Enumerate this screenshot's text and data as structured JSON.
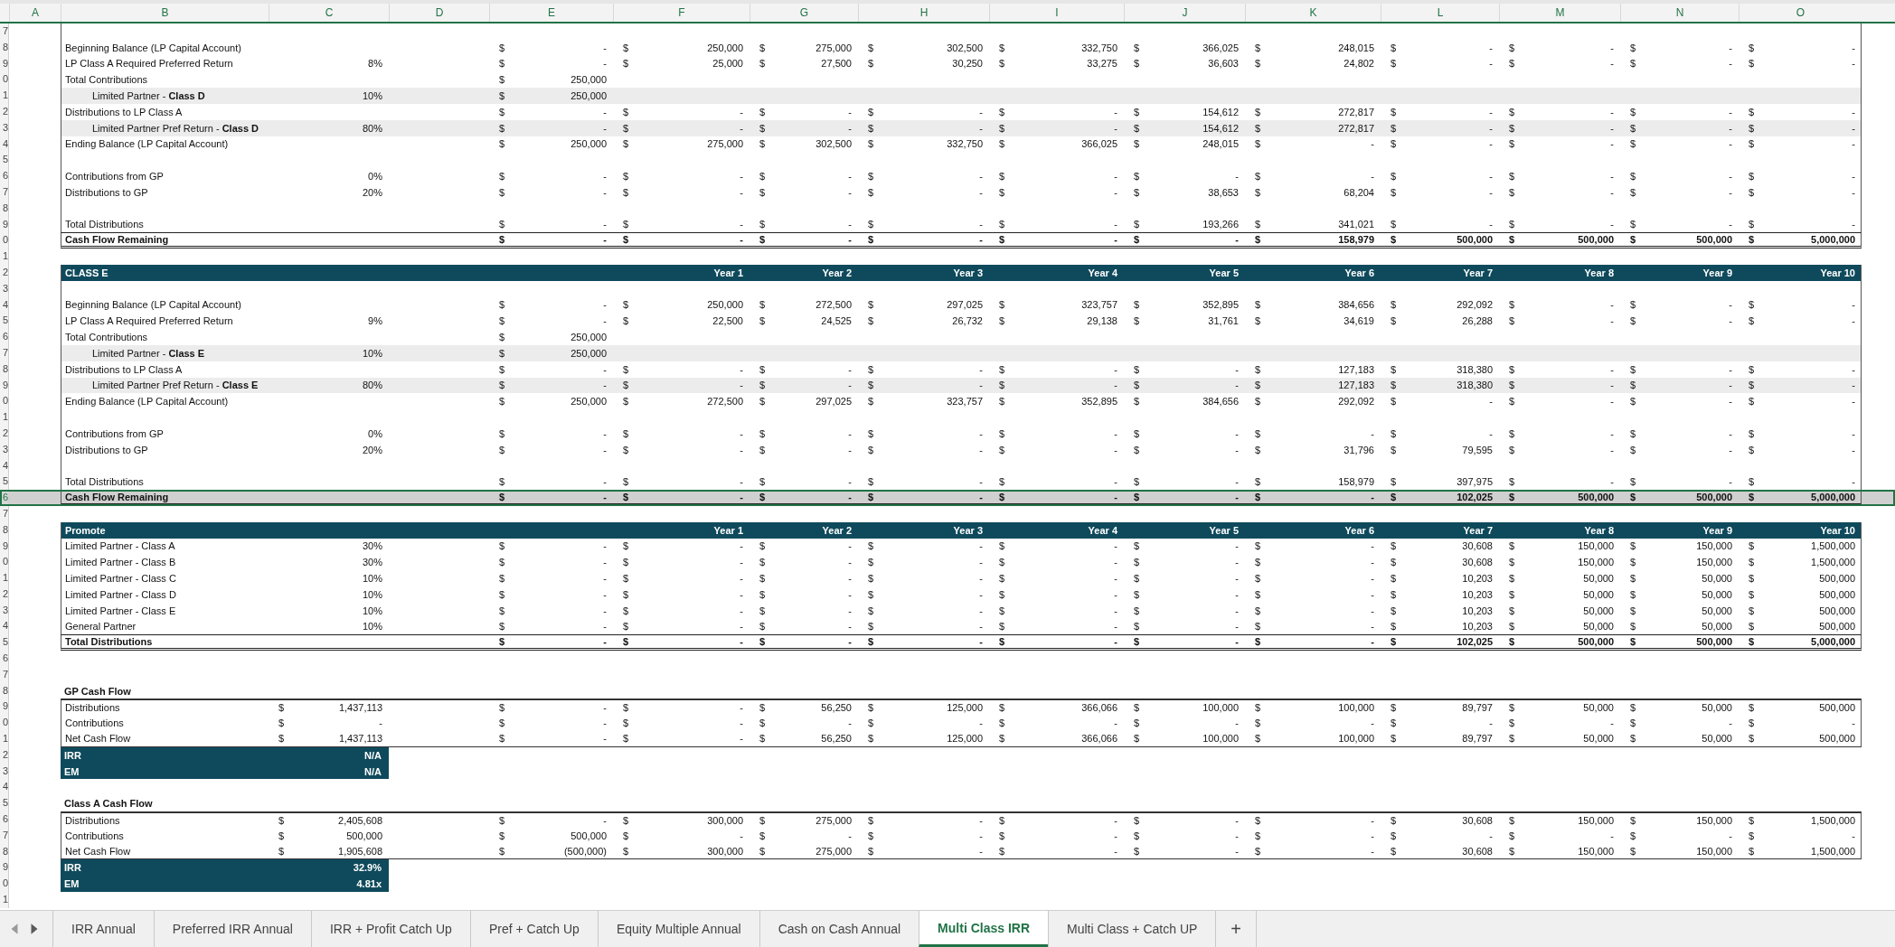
{
  "columns": [
    "A",
    "B",
    "C",
    "D",
    "E",
    "F",
    "G",
    "H",
    "I",
    "J",
    "K",
    "L",
    "M",
    "N",
    "O"
  ],
  "blocks": [
    {
      "kind": "box",
      "rows": [
        {
          "n": "7",
          "kind": "blank",
          "selected": false
        },
        {
          "n": "8",
          "kind": "item",
          "selected": false,
          "label": "Beginning Balance (LP Capital Account)",
          "cells": [
            null,
            null,
            [
              "$",
              "-"
            ],
            [
              "$",
              "250,000"
            ],
            [
              "$",
              "275,000"
            ],
            [
              "$",
              "302,500"
            ],
            [
              "$",
              "332,750"
            ],
            [
              "$",
              "366,025"
            ],
            [
              "$",
              "248,015"
            ],
            [
              "$",
              "-"
            ],
            [
              "$",
              "-"
            ],
            [
              "$",
              "-"
            ],
            [
              "$",
              "-"
            ]
          ]
        },
        {
          "n": "9",
          "kind": "item",
          "selected": false,
          "label": "LP Class A Required Preferred Return",
          "cells": [
            "8%",
            null,
            [
              "$",
              "-"
            ],
            [
              "$",
              "25,000"
            ],
            [
              "$",
              "27,500"
            ],
            [
              "$",
              "30,250"
            ],
            [
              "$",
              "33,275"
            ],
            [
              "$",
              "36,603"
            ],
            [
              "$",
              "24,802"
            ],
            [
              "$",
              "-"
            ],
            [
              "$",
              "-"
            ],
            [
              "$",
              "-"
            ],
            [
              "$",
              "-"
            ]
          ]
        },
        {
          "n": "0",
          "kind": "item",
          "selected": false,
          "label": "Total Contributions",
          "cells": [
            null,
            null,
            [
              "$",
              "250,000"
            ],
            null,
            null,
            null,
            null,
            null,
            null,
            null,
            null,
            null,
            null
          ]
        },
        {
          "n": "1",
          "kind": "sub",
          "selected": false,
          "label": "Limited Partner - **Class D**",
          "cells": [
            "10%",
            null,
            [
              "$",
              "250,000"
            ],
            null,
            null,
            null,
            null,
            null,
            null,
            null,
            null,
            null,
            null
          ]
        },
        {
          "n": "2",
          "kind": "item",
          "selected": false,
          "label": "Distributions to LP Class A",
          "cells": [
            null,
            null,
            [
              "$",
              "-"
            ],
            [
              "$",
              "-"
            ],
            [
              "$",
              "-"
            ],
            [
              "$",
              "-"
            ],
            [
              "$",
              "-"
            ],
            [
              "$",
              "154,612"
            ],
            [
              "$",
              "272,817"
            ],
            [
              "$",
              "-"
            ],
            [
              "$",
              "-"
            ],
            [
              "$",
              "-"
            ],
            [
              "$",
              "-"
            ]
          ]
        },
        {
          "n": "3",
          "kind": "sub",
          "selected": false,
          "label": "Limited Partner Pref Return - **Class D**",
          "cells": [
            "80%",
            null,
            [
              "$",
              "-"
            ],
            [
              "$",
              "-"
            ],
            [
              "$",
              "-"
            ],
            [
              "$",
              "-"
            ],
            [
              "$",
              "-"
            ],
            [
              "$",
              "154,612"
            ],
            [
              "$",
              "272,817"
            ],
            [
              "$",
              "-"
            ],
            [
              "$",
              "-"
            ],
            [
              "$",
              "-"
            ],
            [
              "$",
              "-"
            ]
          ]
        },
        {
          "n": "4",
          "kind": "item",
          "selected": false,
          "label": "Ending Balance (LP Capital Account)",
          "cells": [
            null,
            null,
            [
              "$",
              "250,000"
            ],
            [
              "$",
              "275,000"
            ],
            [
              "$",
              "302,500"
            ],
            [
              "$",
              "332,750"
            ],
            [
              "$",
              "366,025"
            ],
            [
              "$",
              "248,015"
            ],
            [
              "$",
              "-"
            ],
            [
              "$",
              "-"
            ],
            [
              "$",
              "-"
            ],
            [
              "$",
              "-"
            ],
            [
              "$",
              "-"
            ]
          ]
        },
        {
          "n": "5",
          "kind": "blank",
          "selected": false
        },
        {
          "n": "6",
          "kind": "item",
          "selected": false,
          "label": "Contributions from GP",
          "cells": [
            "0%",
            null,
            [
              "$",
              "-"
            ],
            [
              "$",
              "-"
            ],
            [
              "$",
              "-"
            ],
            [
              "$",
              "-"
            ],
            [
              "$",
              "-"
            ],
            [
              "$",
              "-"
            ],
            [
              "$",
              "-"
            ],
            [
              "$",
              "-"
            ],
            [
              "$",
              "-"
            ],
            [
              "$",
              "-"
            ],
            [
              "$",
              "-"
            ]
          ]
        },
        {
          "n": "7",
          "kind": "item",
          "selected": false,
          "label": "Distributions to GP",
          "cells": [
            "20%",
            null,
            [
              "$",
              "-"
            ],
            [
              "$",
              "-"
            ],
            [
              "$",
              "-"
            ],
            [
              "$",
              "-"
            ],
            [
              "$",
              "-"
            ],
            [
              "$",
              "38,653"
            ],
            [
              "$",
              "68,204"
            ],
            [
              "$",
              "-"
            ],
            [
              "$",
              "-"
            ],
            [
              "$",
              "-"
            ],
            [
              "$",
              "-"
            ]
          ]
        },
        {
          "n": "8",
          "kind": "blank",
          "selected": false
        },
        {
          "n": "9",
          "kind": "item",
          "selected": false,
          "label": "Total Distributions",
          "cells": [
            null,
            null,
            [
              "$",
              "-"
            ],
            [
              "$",
              "-"
            ],
            [
              "$",
              "-"
            ],
            [
              "$",
              "-"
            ],
            [
              "$",
              "-"
            ],
            [
              "$",
              "193,266"
            ],
            [
              "$",
              "341,021"
            ],
            [
              "$",
              "-"
            ],
            [
              "$",
              "-"
            ],
            [
              "$",
              "-"
            ],
            [
              "$",
              "-"
            ]
          ]
        },
        {
          "n": "0",
          "kind": "total",
          "selected": false,
          "label": "Cash Flow Remaining",
          "cells": [
            null,
            null,
            [
              "$",
              "-"
            ],
            [
              "$",
              "-"
            ],
            [
              "$",
              "-"
            ],
            [
              "$",
              "-"
            ],
            [
              "$",
              "-"
            ],
            [
              "$",
              "-"
            ],
            [
              "$",
              "158,979"
            ],
            [
              "$",
              "500,000"
            ],
            [
              "$",
              "500,000"
            ],
            [
              "$",
              "500,000"
            ],
            [
              "$",
              "5,000,000"
            ]
          ]
        }
      ]
    },
    {
      "kind": "plain",
      "rows": [
        {
          "n": "1",
          "kind": "blank",
          "selected": false
        }
      ]
    },
    {
      "kind": "box",
      "rows": [
        {
          "n": "2",
          "kind": "header",
          "selected": false,
          "label": "CLASS E",
          "cells": [
            null,
            null,
            null,
            "Year 1",
            "Year 2",
            "Year 3",
            "Year 4",
            "Year 5",
            "Year 6",
            "Year 7",
            "Year 8",
            "Year 9",
            "Year 10"
          ]
        },
        {
          "n": "3",
          "kind": "blank",
          "selected": false
        },
        {
          "n": "4",
          "kind": "item",
          "selected": false,
          "label": "Beginning Balance (LP Capital Account)",
          "cells": [
            null,
            null,
            [
              "$",
              "-"
            ],
            [
              "$",
              "250,000"
            ],
            [
              "$",
              "272,500"
            ],
            [
              "$",
              "297,025"
            ],
            [
              "$",
              "323,757"
            ],
            [
              "$",
              "352,895"
            ],
            [
              "$",
              "384,656"
            ],
            [
              "$",
              "292,092"
            ],
            [
              "$",
              "-"
            ],
            [
              "$",
              "-"
            ],
            [
              "$",
              "-"
            ]
          ]
        },
        {
          "n": "5",
          "kind": "item",
          "selected": false,
          "label": "LP Class A Required Preferred Return",
          "cells": [
            "9%",
            null,
            [
              "$",
              "-"
            ],
            [
              "$",
              "22,500"
            ],
            [
              "$",
              "24,525"
            ],
            [
              "$",
              "26,732"
            ],
            [
              "$",
              "29,138"
            ],
            [
              "$",
              "31,761"
            ],
            [
              "$",
              "34,619"
            ],
            [
              "$",
              "26,288"
            ],
            [
              "$",
              "-"
            ],
            [
              "$",
              "-"
            ],
            [
              "$",
              "-"
            ]
          ]
        },
        {
          "n": "6",
          "kind": "item",
          "selected": false,
          "label": "Total Contributions",
          "cells": [
            null,
            null,
            [
              "$",
              "250,000"
            ],
            null,
            null,
            null,
            null,
            null,
            null,
            null,
            null,
            null,
            null
          ]
        },
        {
          "n": "7",
          "kind": "sub",
          "selected": false,
          "label": "Limited Partner - **Class E**",
          "cells": [
            "10%",
            null,
            [
              "$",
              "250,000"
            ],
            null,
            null,
            null,
            null,
            null,
            null,
            null,
            null,
            null,
            null
          ]
        },
        {
          "n": "8",
          "kind": "item",
          "selected": false,
          "label": "Distributions to LP Class A",
          "cells": [
            null,
            null,
            [
              "$",
              "-"
            ],
            [
              "$",
              "-"
            ],
            [
              "$",
              "-"
            ],
            [
              "$",
              "-"
            ],
            [
              "$",
              "-"
            ],
            [
              "$",
              "-"
            ],
            [
              "$",
              "127,183"
            ],
            [
              "$",
              "318,380"
            ],
            [
              "$",
              "-"
            ],
            [
              "$",
              "-"
            ],
            [
              "$",
              "-"
            ]
          ]
        },
        {
          "n": "9",
          "kind": "sub",
          "selected": false,
          "label": "Limited Partner Pref Return - **Class E**",
          "cells": [
            "80%",
            null,
            [
              "$",
              "-"
            ],
            [
              "$",
              "-"
            ],
            [
              "$",
              "-"
            ],
            [
              "$",
              "-"
            ],
            [
              "$",
              "-"
            ],
            [
              "$",
              "-"
            ],
            [
              "$",
              "127,183"
            ],
            [
              "$",
              "318,380"
            ],
            [
              "$",
              "-"
            ],
            [
              "$",
              "-"
            ],
            [
              "$",
              "-"
            ]
          ]
        },
        {
          "n": "0",
          "kind": "item",
          "selected": false,
          "label": "Ending Balance (LP Capital Account)",
          "cells": [
            null,
            null,
            [
              "$",
              "250,000"
            ],
            [
              "$",
              "272,500"
            ],
            [
              "$",
              "297,025"
            ],
            [
              "$",
              "323,757"
            ],
            [
              "$",
              "352,895"
            ],
            [
              "$",
              "384,656"
            ],
            [
              "$",
              "292,092"
            ],
            [
              "$",
              "-"
            ],
            [
              "$",
              "-"
            ],
            [
              "$",
              "-"
            ],
            [
              "$",
              "-"
            ]
          ]
        },
        {
          "n": "1",
          "kind": "blank",
          "selected": false
        },
        {
          "n": "2",
          "kind": "item",
          "selected": false,
          "label": "Contributions from GP",
          "cells": [
            "0%",
            null,
            [
              "$",
              "-"
            ],
            [
              "$",
              "-"
            ],
            [
              "$",
              "-"
            ],
            [
              "$",
              "-"
            ],
            [
              "$",
              "-"
            ],
            [
              "$",
              "-"
            ],
            [
              "$",
              "-"
            ],
            [
              "$",
              "-"
            ],
            [
              "$",
              "-"
            ],
            [
              "$",
              "-"
            ],
            [
              "$",
              "-"
            ]
          ]
        },
        {
          "n": "3",
          "kind": "item",
          "selected": false,
          "label": "Distributions to GP",
          "cells": [
            "20%",
            null,
            [
              "$",
              "-"
            ],
            [
              "$",
              "-"
            ],
            [
              "$",
              "-"
            ],
            [
              "$",
              "-"
            ],
            [
              "$",
              "-"
            ],
            [
              "$",
              "-"
            ],
            [
              "$",
              "31,796"
            ],
            [
              "$",
              "79,595"
            ],
            [
              "$",
              "-"
            ],
            [
              "$",
              "-"
            ],
            [
              "$",
              "-"
            ]
          ]
        },
        {
          "n": "4",
          "kind": "blank",
          "selected": false
        },
        {
          "n": "5",
          "kind": "item",
          "selected": false,
          "label": "Total Distributions",
          "cells": [
            null,
            null,
            [
              "$",
              "-"
            ],
            [
              "$",
              "-"
            ],
            [
              "$",
              "-"
            ],
            [
              "$",
              "-"
            ],
            [
              "$",
              "-"
            ],
            [
              "$",
              "-"
            ],
            [
              "$",
              "158,979"
            ],
            [
              "$",
              "397,975"
            ],
            [
              "$",
              "-"
            ],
            [
              "$",
              "-"
            ],
            [
              "$",
              "-"
            ]
          ]
        },
        {
          "n": "6",
          "kind": "total",
          "selected": true,
          "label": "Cash Flow Remaining",
          "cells": [
            null,
            null,
            [
              "$",
              "-"
            ],
            [
              "$",
              "-"
            ],
            [
              "$",
              "-"
            ],
            [
              "$",
              "-"
            ],
            [
              "$",
              "-"
            ],
            [
              "$",
              "-"
            ],
            [
              "$",
              "-"
            ],
            [
              "$",
              "102,025"
            ],
            [
              "$",
              "500,000"
            ],
            [
              "$",
              "500,000"
            ],
            [
              "$",
              "5,000,000"
            ]
          ]
        }
      ]
    },
    {
      "kind": "plain",
      "rows": [
        {
          "n": "7",
          "kind": "blank",
          "selected": false
        }
      ]
    },
    {
      "kind": "box",
      "rows": [
        {
          "n": "8",
          "kind": "header",
          "selected": false,
          "label": "Promote",
          "cells": [
            null,
            null,
            null,
            "Year 1",
            "Year 2",
            "Year 3",
            "Year 4",
            "Year 5",
            "Year 6",
            "Year 7",
            "Year 8",
            "Year 9",
            "Year 10"
          ]
        },
        {
          "n": "9",
          "kind": "item",
          "selected": false,
          "label": "Limited Partner - Class A",
          "cells": [
            "30%",
            null,
            [
              "$",
              "-"
            ],
            [
              "$",
              "-"
            ],
            [
              "$",
              "-"
            ],
            [
              "$",
              "-"
            ],
            [
              "$",
              "-"
            ],
            [
              "$",
              "-"
            ],
            [
              "$",
              "-"
            ],
            [
              "$",
              "30,608"
            ],
            [
              "$",
              "150,000"
            ],
            [
              "$",
              "150,000"
            ],
            [
              "$",
              "1,500,000"
            ]
          ]
        },
        {
          "n": "0",
          "kind": "item",
          "selected": false,
          "label": "Limited Partner - Class B",
          "cells": [
            "30%",
            null,
            [
              "$",
              "-"
            ],
            [
              "$",
              "-"
            ],
            [
              "$",
              "-"
            ],
            [
              "$",
              "-"
            ],
            [
              "$",
              "-"
            ],
            [
              "$",
              "-"
            ],
            [
              "$",
              "-"
            ],
            [
              "$",
              "30,608"
            ],
            [
              "$",
              "150,000"
            ],
            [
              "$",
              "150,000"
            ],
            [
              "$",
              "1,500,000"
            ]
          ]
        },
        {
          "n": "1",
          "kind": "item",
          "selected": false,
          "label": "Limited Partner - Class C",
          "cells": [
            "10%",
            null,
            [
              "$",
              "-"
            ],
            [
              "$",
              "-"
            ],
            [
              "$",
              "-"
            ],
            [
              "$",
              "-"
            ],
            [
              "$",
              "-"
            ],
            [
              "$",
              "-"
            ],
            [
              "$",
              "-"
            ],
            [
              "$",
              "10,203"
            ],
            [
              "$",
              "50,000"
            ],
            [
              "$",
              "50,000"
            ],
            [
              "$",
              "500,000"
            ]
          ]
        },
        {
          "n": "2",
          "kind": "item",
          "selected": false,
          "label": "Limited Partner - Class D",
          "cells": [
            "10%",
            null,
            [
              "$",
              "-"
            ],
            [
              "$",
              "-"
            ],
            [
              "$",
              "-"
            ],
            [
              "$",
              "-"
            ],
            [
              "$",
              "-"
            ],
            [
              "$",
              "-"
            ],
            [
              "$",
              "-"
            ],
            [
              "$",
              "10,203"
            ],
            [
              "$",
              "50,000"
            ],
            [
              "$",
              "50,000"
            ],
            [
              "$",
              "500,000"
            ]
          ]
        },
        {
          "n": "3",
          "kind": "item",
          "selected": false,
          "label": "Limited Partner - Class E",
          "cells": [
            "10%",
            null,
            [
              "$",
              "-"
            ],
            [
              "$",
              "-"
            ],
            [
              "$",
              "-"
            ],
            [
              "$",
              "-"
            ],
            [
              "$",
              "-"
            ],
            [
              "$",
              "-"
            ],
            [
              "$",
              "-"
            ],
            [
              "$",
              "10,203"
            ],
            [
              "$",
              "50,000"
            ],
            [
              "$",
              "50,000"
            ],
            [
              "$",
              "500,000"
            ]
          ]
        },
        {
          "n": "4",
          "kind": "item",
          "selected": false,
          "label": "General Partner",
          "cells": [
            "10%",
            null,
            [
              "$",
              "-"
            ],
            [
              "$",
              "-"
            ],
            [
              "$",
              "-"
            ],
            [
              "$",
              "-"
            ],
            [
              "$",
              "-"
            ],
            [
              "$",
              "-"
            ],
            [
              "$",
              "-"
            ],
            [
              "$",
              "10,203"
            ],
            [
              "$",
              "50,000"
            ],
            [
              "$",
              "50,000"
            ],
            [
              "$",
              "500,000"
            ]
          ]
        },
        {
          "n": "5",
          "kind": "total",
          "selected": false,
          "label": "Total Distributions",
          "cells": [
            null,
            null,
            [
              "$",
              "-"
            ],
            [
              "$",
              "-"
            ],
            [
              "$",
              "-"
            ],
            [
              "$",
              "-"
            ],
            [
              "$",
              "-"
            ],
            [
              "$",
              "-"
            ],
            [
              "$",
              "-"
            ],
            [
              "$",
              "102,025"
            ],
            [
              "$",
              "500,000"
            ],
            [
              "$",
              "500,000"
            ],
            [
              "$",
              "5,000,000"
            ]
          ]
        }
      ]
    },
    {
      "kind": "plain",
      "rows": [
        {
          "n": "6",
          "kind": "blank",
          "selected": false
        },
        {
          "n": "7",
          "kind": "blank",
          "selected": false
        },
        {
          "n": "8",
          "kind": "title",
          "selected": false,
          "label": "GP Cash Flow"
        }
      ]
    },
    {
      "kind": "box-closed",
      "rows": [
        {
          "n": "9",
          "kind": "item",
          "selected": false,
          "label": "Distributions",
          "cells": [
            [
              "$",
              "1,437,113"
            ],
            null,
            [
              "$",
              "-"
            ],
            [
              "$",
              "-"
            ],
            [
              "$",
              "56,250"
            ],
            [
              "$",
              "125,000"
            ],
            [
              "$",
              "366,066"
            ],
            [
              "$",
              "100,000"
            ],
            [
              "$",
              "100,000"
            ],
            [
              "$",
              "89,797"
            ],
            [
              "$",
              "50,000"
            ],
            [
              "$",
              "50,000"
            ],
            [
              "$",
              "500,000"
            ]
          ]
        },
        {
          "n": "0",
          "kind": "item",
          "selected": false,
          "label": "Contributions",
          "cells": [
            [
              "$",
              "-"
            ],
            null,
            [
              "$",
              "-"
            ],
            [
              "$",
              "-"
            ],
            [
              "$",
              "-"
            ],
            [
              "$",
              "-"
            ],
            [
              "$",
              "-"
            ],
            [
              "$",
              "-"
            ],
            [
              "$",
              "-"
            ],
            [
              "$",
              "-"
            ],
            [
              "$",
              "-"
            ],
            [
              "$",
              "-"
            ],
            [
              "$",
              "-"
            ]
          ]
        },
        {
          "n": "1",
          "kind": "item",
          "selected": false,
          "label": "Net Cash Flow",
          "cells": [
            [
              "$",
              "1,437,113"
            ],
            null,
            [
              "$",
              "-"
            ],
            [
              "$",
              "-"
            ],
            [
              "$",
              "56,250"
            ],
            [
              "$",
              "125,000"
            ],
            [
              "$",
              "366,066"
            ],
            [
              "$",
              "100,000"
            ],
            [
              "$",
              "100,000"
            ],
            [
              "$",
              "89,797"
            ],
            [
              "$",
              "50,000"
            ],
            [
              "$",
              "50,000"
            ],
            [
              "$",
              "500,000"
            ]
          ]
        }
      ]
    },
    {
      "kind": "plain",
      "rows": [
        {
          "n": "2",
          "kind": "metric",
          "selected": false,
          "label": "IRR",
          "cells": [
            "N/A"
          ]
        },
        {
          "n": "3",
          "kind": "metric",
          "selected": false,
          "label": "EM",
          "cells": [
            "N/A"
          ]
        },
        {
          "n": "4",
          "kind": "blank",
          "selected": false
        },
        {
          "n": "5",
          "kind": "title",
          "selected": false,
          "label": "Class A Cash Flow"
        }
      ]
    },
    {
      "kind": "box-closed",
      "rows": [
        {
          "n": "6",
          "kind": "item",
          "selected": false,
          "label": "Distributions",
          "cells": [
            [
              "$",
              "2,405,608"
            ],
            null,
            [
              "$",
              "-"
            ],
            [
              "$",
              "300,000"
            ],
            [
              "$",
              "275,000"
            ],
            [
              "$",
              "-"
            ],
            [
              "$",
              "-"
            ],
            [
              "$",
              "-"
            ],
            [
              "$",
              "-"
            ],
            [
              "$",
              "30,608"
            ],
            [
              "$",
              "150,000"
            ],
            [
              "$",
              "150,000"
            ],
            [
              "$",
              "1,500,000"
            ]
          ]
        },
        {
          "n": "7",
          "kind": "item",
          "selected": false,
          "label": "Contributions",
          "cells": [
            [
              "$",
              "500,000"
            ],
            null,
            [
              "$",
              "500,000"
            ],
            [
              "$",
              "-"
            ],
            [
              "$",
              "-"
            ],
            [
              "$",
              "-"
            ],
            [
              "$",
              "-"
            ],
            [
              "$",
              "-"
            ],
            [
              "$",
              "-"
            ],
            [
              "$",
              "-"
            ],
            [
              "$",
              "-"
            ],
            [
              "$",
              "-"
            ],
            [
              "$",
              "-"
            ]
          ]
        },
        {
          "n": "8",
          "kind": "item",
          "selected": false,
          "label": "Net Cash Flow",
          "cells": [
            [
              "$",
              "1,905,608"
            ],
            null,
            [
              "$",
              "(500,000)"
            ],
            [
              "$",
              "300,000"
            ],
            [
              "$",
              "275,000"
            ],
            [
              "$",
              "-"
            ],
            [
              "$",
              "-"
            ],
            [
              "$",
              "-"
            ],
            [
              "$",
              "-"
            ],
            [
              "$",
              "30,608"
            ],
            [
              "$",
              "150,000"
            ],
            [
              "$",
              "150,000"
            ],
            [
              "$",
              "1,500,000"
            ]
          ]
        }
      ]
    },
    {
      "kind": "plain",
      "rows": [
        {
          "n": "9",
          "kind": "metric",
          "selected": false,
          "label": "IRR",
          "cells": [
            "32.9%"
          ]
        },
        {
          "n": "0",
          "kind": "metric",
          "selected": false,
          "label": "EM",
          "cells": [
            "4.81x"
          ]
        },
        {
          "n": "1",
          "kind": "blank",
          "selected": false
        }
      ]
    }
  ],
  "tabs": [
    {
      "label": "IRR Annual",
      "selected": false
    },
    {
      "label": "Preferred IRR Annual",
      "selected": false
    },
    {
      "label": "IRR + Profit Catch Up",
      "selected": false
    },
    {
      "label": "Pref + Catch Up",
      "selected": false
    },
    {
      "label": "Equity Multiple Annual",
      "selected": false
    },
    {
      "label": "Cash on Cash Annual",
      "selected": false
    },
    {
      "label": "Multi Class IRR",
      "selected": true
    },
    {
      "label": "Multi Class + Catch UP",
      "selected": false
    }
  ],
  "add_sheet": "+"
}
